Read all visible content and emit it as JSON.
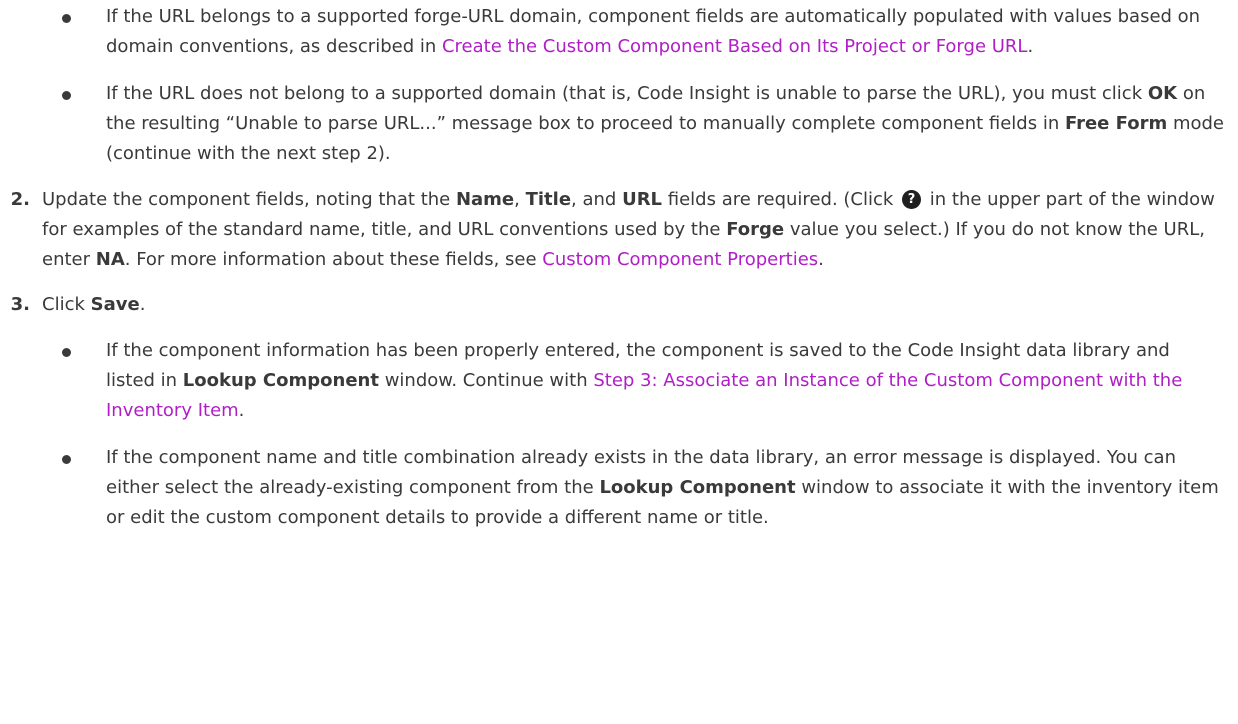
{
  "bullets_step1": [
    {
      "pre": "If the URL belongs to a supported forge-URL domain, component fields are automatically populated with values based on domain conventions, as described in ",
      "link": "Create the Custom Component Based on Its Project or Forge URL",
      "post": "."
    },
    {
      "pre": "If the URL does not belong to a supported domain (that is, Code Insight is unable to parse the URL), you must click ",
      "ok": "OK",
      "mid": " on the resulting “Unable to parse URL...” message box to proceed to manually complete component fields in ",
      "free_form": "Free Form",
      "post": " mode (continue with the next step 2)."
    }
  ],
  "step2": {
    "number": "2.",
    "t1": "Update the component fields, noting that the ",
    "name": "Name",
    "t2": ", ",
    "title": "Title",
    "t3": ", and ",
    "url": "URL",
    "t4": " fields are required. (Click ",
    "help_glyph": "?",
    "t5": " in the upper part of the window for examples of the standard name, title, and URL conventions used by the ",
    "forge": "Forge",
    "t6": " value you select.) If you do not know the URL, enter ",
    "na": "NA",
    "t7": ". For more information about these fields, see ",
    "link": "Custom Component Properties",
    "t8": "."
  },
  "step3": {
    "number": "3.",
    "pre": "Click ",
    "save": "Save",
    "post": "."
  },
  "bullets_step3": [
    {
      "pre": "If the component information has been properly entered, the component is saved to the Code Insight data library and listed in ",
      "lookup": "Lookup Component",
      "mid": " window. Continue with ",
      "link": "Step 3: Associate an Instance of the Custom Component with the Inventory Item",
      "post": "."
    },
    {
      "pre": "If the component name and title combination already exists in the data library, an error message is displayed. You can either select the already-existing component from the ",
      "lookup": "Lookup Component",
      "post": " window to associate it with the inventory item or edit the custom component details to provide a different name or title."
    }
  ]
}
